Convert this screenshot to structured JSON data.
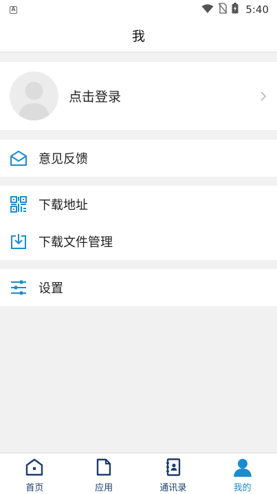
{
  "status_bar": {
    "time": "5:40"
  },
  "header": {
    "title": "我"
  },
  "profile": {
    "login_label": "点击登录"
  },
  "menu": {
    "feedback": "意见反馈",
    "download_address": "下载地址",
    "download_manager": "下载文件管理",
    "settings": "设置"
  },
  "tabs": [
    {
      "label": "首页",
      "icon": "home-icon",
      "active": false
    },
    {
      "label": "应用",
      "icon": "document-icon",
      "active": false
    },
    {
      "label": "通讯录",
      "icon": "contacts-icon",
      "active": false
    },
    {
      "label": "我的",
      "icon": "person-icon",
      "active": true
    }
  ],
  "colors": {
    "accent": "#1a8cd0",
    "tab_inactive": "#1b3d6e",
    "background": "#f1f1f1"
  }
}
